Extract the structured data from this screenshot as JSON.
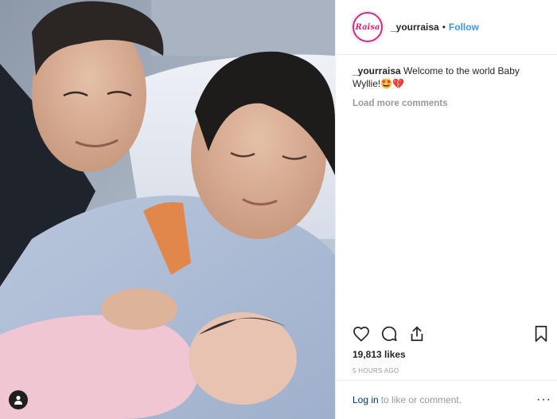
{
  "post": {
    "username": "_yourraisa",
    "avatar_text": "Raisa",
    "separator": "•",
    "follow_label": "Follow",
    "caption_user": "_yourraisa",
    "caption_text": "Welcome to the world Baby Wyllie!🤩💔",
    "load_more_label": "Load more comments",
    "likes": "19,813 likes",
    "time_ago": "5 HOURS AGO",
    "login_label": "Log in",
    "login_suffix": "to like or comment.",
    "more_label": "···"
  },
  "colors": {
    "brand_pink": "#d8277c",
    "link_blue": "#3897f0",
    "text_dark": "#262626",
    "text_muted": "#999999"
  },
  "icons": [
    "heart-icon",
    "comment-icon",
    "share-icon",
    "bookmark-icon",
    "user-tag-icon"
  ]
}
